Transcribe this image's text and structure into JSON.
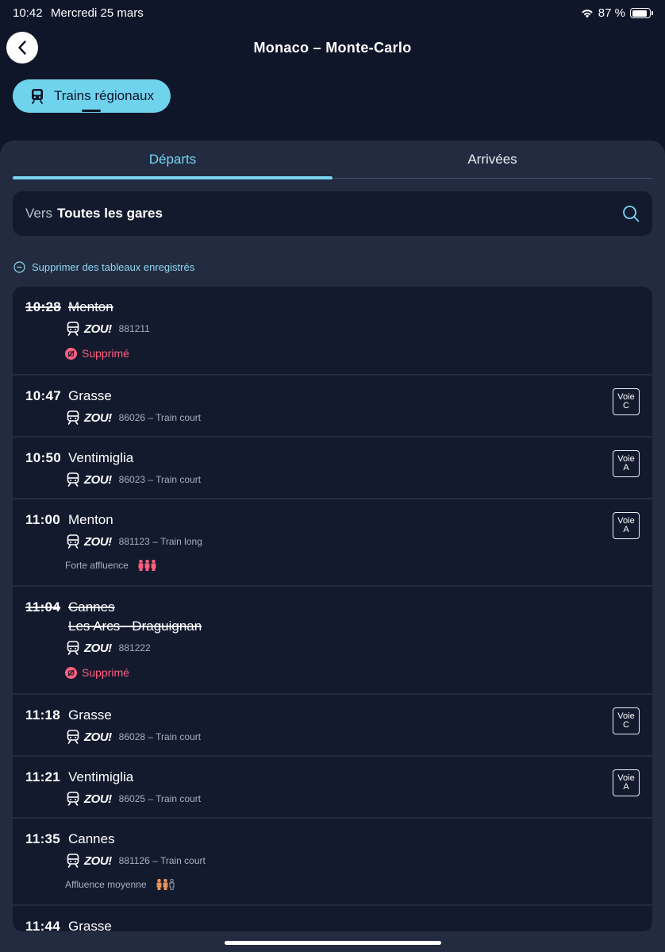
{
  "status_bar": {
    "time": "10:42",
    "date": "Mercredi 25 mars",
    "battery": "87 %"
  },
  "header": {
    "title": "Monaco – Monte-Carlo"
  },
  "mode": {
    "label": "Trains régionaux"
  },
  "tabs": [
    {
      "label": "Départs",
      "active": true
    },
    {
      "label": "Arrivées",
      "active": false
    }
  ],
  "search": {
    "prefix": "Vers",
    "value": "Toutes les gares"
  },
  "remove_link": "Supprimer des tableaux enregistrés",
  "departures": [
    {
      "time": "10:28",
      "destination": "Menton",
      "destination2": "",
      "brand": "ZOU!",
      "train": "881211",
      "voie_label": "",
      "voie": "",
      "status": "Supprimé",
      "affluence": "",
      "affluence_level": 0
    },
    {
      "time": "10:47",
      "destination": "Grasse",
      "destination2": "",
      "brand": "ZOU!",
      "train": "86026 – Train court",
      "voie_label": "Voie",
      "voie": "C",
      "status": "",
      "affluence": "",
      "affluence_level": 0
    },
    {
      "time": "10:50",
      "destination": "Ventimiglia",
      "destination2": "",
      "brand": "ZOU!",
      "train": "86023 – Train court",
      "voie_label": "Voie",
      "voie": "A",
      "status": "",
      "affluence": "",
      "affluence_level": 0
    },
    {
      "time": "11:00",
      "destination": "Menton",
      "destination2": "",
      "brand": "ZOU!",
      "train": "881123 – Train long",
      "voie_label": "Voie",
      "voie": "A",
      "status": "",
      "affluence": "Forte affluence",
      "affluence_level": 3
    },
    {
      "time": "11:04",
      "destination": "Cannes",
      "destination2": "Les Arcs - Draguignan",
      "brand": "ZOU!",
      "train": "881222",
      "voie_label": "",
      "voie": "",
      "status": "Supprimé",
      "affluence": "",
      "affluence_level": 0
    },
    {
      "time": "11:18",
      "destination": "Grasse",
      "destination2": "",
      "brand": "ZOU!",
      "train": "86028 – Train court",
      "voie_label": "Voie",
      "voie": "C",
      "status": "",
      "affluence": "",
      "affluence_level": 0
    },
    {
      "time": "11:21",
      "destination": "Ventimiglia",
      "destination2": "",
      "brand": "ZOU!",
      "train": "86025 – Train court",
      "voie_label": "Voie",
      "voie": "A",
      "status": "",
      "affluence": "",
      "affluence_level": 0
    },
    {
      "time": "11:35",
      "destination": "Cannes",
      "destination2": "",
      "brand": "ZOU!",
      "train": "881126 – Train court",
      "voie_label": "",
      "voie": "",
      "status": "",
      "affluence": "Affluence moyenne",
      "affluence_level": 2
    },
    {
      "time": "11:44",
      "destination": "Grasse",
      "destination2": "",
      "brand": "ZOU!",
      "train": "",
      "voie_label": "",
      "voie": "",
      "status": "",
      "affluence": "",
      "affluence_level": 0
    }
  ],
  "colors": {
    "background": "#0f1629",
    "accent": "#78d6f0",
    "pill": "#6fd3ee",
    "cancelled": "#ff5f7e",
    "crowd_high": "#ff5f7e",
    "crowd_mid": "#e8935a"
  },
  "icons": {
    "back": "chevron-left-icon",
    "train": "train-icon",
    "search": "search-icon",
    "remove": "minus-circle-icon",
    "cancelled": "cancelled-icon",
    "crowd": "person-icon"
  }
}
